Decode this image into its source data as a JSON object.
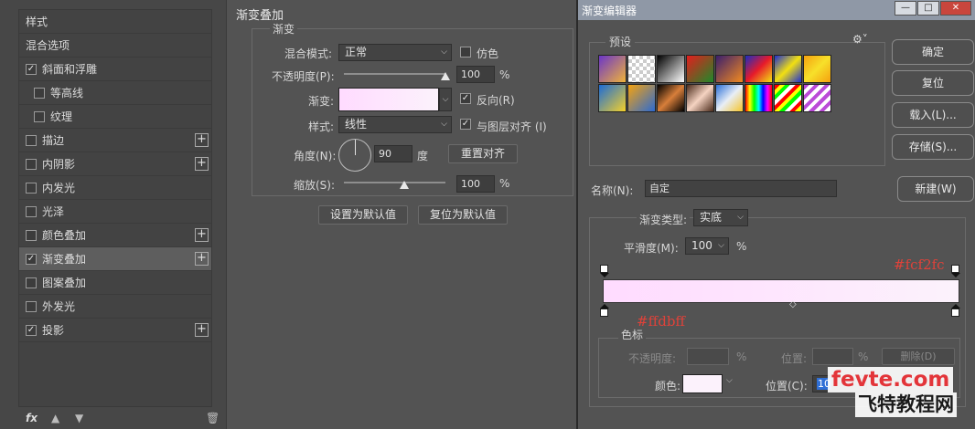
{
  "styles_panel": {
    "header": "样式",
    "items": [
      {
        "label": "混合选项",
        "checkbox": false,
        "checked": false,
        "plus": false
      },
      {
        "label": "斜面和浮雕",
        "checkbox": true,
        "checked": true,
        "plus": false
      },
      {
        "label": "等高线",
        "checkbox": true,
        "checked": false,
        "plus": false,
        "indent": true
      },
      {
        "label": "纹理",
        "checkbox": true,
        "checked": false,
        "plus": false,
        "indent": true
      },
      {
        "label": "描边",
        "checkbox": true,
        "checked": false,
        "plus": true
      },
      {
        "label": "内阴影",
        "checkbox": true,
        "checked": false,
        "plus": true
      },
      {
        "label": "内发光",
        "checkbox": true,
        "checked": false,
        "plus": false
      },
      {
        "label": "光泽",
        "checkbox": true,
        "checked": false,
        "plus": false
      },
      {
        "label": "颜色叠加",
        "checkbox": true,
        "checked": false,
        "plus": true
      },
      {
        "label": "渐变叠加",
        "checkbox": true,
        "checked": true,
        "plus": true,
        "selected": true
      },
      {
        "label": "图案叠加",
        "checkbox": true,
        "checked": false,
        "plus": false
      },
      {
        "label": "外发光",
        "checkbox": true,
        "checked": false,
        "plus": false
      },
      {
        "label": "投影",
        "checkbox": true,
        "checked": true,
        "plus": true
      }
    ],
    "footer": {
      "fx": "fx"
    }
  },
  "gradient_overlay": {
    "section_title": "渐变叠加",
    "group_title": "渐变",
    "blend_mode_label": "混合模式:",
    "blend_mode_value": "正常",
    "dither_label": "仿色",
    "opacity_label": "不透明度(P):",
    "opacity_value": "100",
    "opacity_unit": "%",
    "opacity_level": 100,
    "gradient_label": "渐变:",
    "reverse_label": "反向(R)",
    "style_label": "样式:",
    "style_value": "线性",
    "align_label": "与图层对齐 (I)",
    "angle_label": "角度(N):",
    "angle_value": "90",
    "angle_unit": "度",
    "reset_align_label": "重置对齐",
    "scale_label": "缩放(S):",
    "scale_value": "100",
    "scale_unit": "%",
    "set_default_label": "设置为默认值",
    "reset_default_label": "复位为默认值"
  },
  "gradient_editor": {
    "title": "渐变编辑器",
    "presets_label": "预设",
    "buttons": {
      "ok": "确定",
      "reset": "复位",
      "load": "载入(L)...",
      "save": "存储(S)...",
      "new": "新建(W)"
    },
    "name_label": "名称(N):",
    "name_value": "自定",
    "gradient_type_label": "渐变类型:",
    "gradient_type_value": "实底",
    "smoothness_label": "平滑度(M):",
    "smoothness_value": "100",
    "smoothness_unit": "%",
    "annotation_right": "#fcf2fc",
    "annotation_left": "#ffdbff",
    "stops_group_label": "色标",
    "stop_opacity_label": "不透明度:",
    "stop_opacity_unit": "%",
    "stop_position_label": "位置:",
    "stop_position_unit": "%",
    "delete_label": "删除(D)",
    "color_label": "颜色:",
    "color_position_label": "位置(C):",
    "color_position_value": "10",
    "gradient_start_color": "#ffdbff",
    "gradient_end_color": "#fcf2fc"
  },
  "watermark": {
    "line1": "fevte.com",
    "line2": "飞特教程网"
  }
}
